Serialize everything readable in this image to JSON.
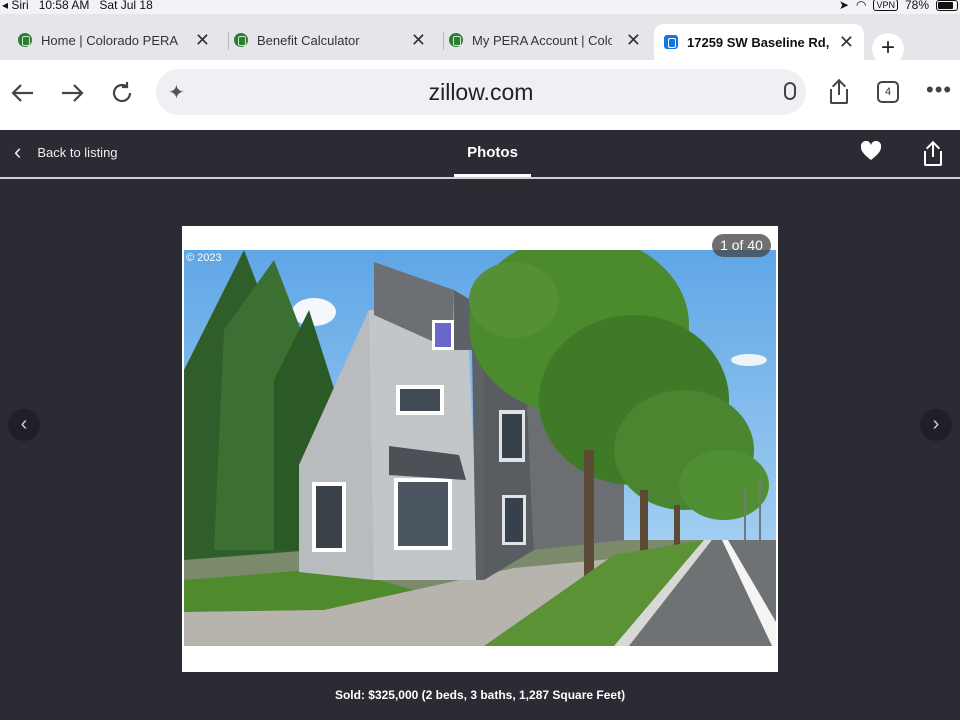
{
  "status": {
    "siri": "◂ Siri",
    "time": "10:58 AM",
    "date": "Sat Jul 18",
    "vpn": "VPN",
    "battery": "78%"
  },
  "tabs": [
    {
      "title": "Home | Colorado PERA",
      "active": false
    },
    {
      "title": "Benefit Calculator",
      "active": false
    },
    {
      "title": "My PERA Account | Colo",
      "active": false
    },
    {
      "title": "17259 SW Baseline Rd, ",
      "active": true
    }
  ],
  "new_tab_label": "+",
  "toolbar": {
    "url": "zillow.com",
    "tab_count": "4",
    "more": "•••"
  },
  "photo_header": {
    "back_label": "Back to listing",
    "title": "Photos"
  },
  "viewer": {
    "counter": "1 of 40",
    "copyright": "© 2023",
    "prev_glyph": "‹",
    "next_glyph": "›",
    "caption": "Sold: $325,000 (2 beds, 3 baths, 1,287 Square Feet)"
  },
  "icons": {
    "back": "arrow-left-icon",
    "forward": "arrow-right-icon",
    "reload": "reload-icon",
    "share": "share-icon",
    "heart": "heart-icon"
  },
  "colors": {
    "viewer_bg": "#2a2b33",
    "zillow_blue": "#1277e1",
    "pera_green": "#2e7d32"
  }
}
